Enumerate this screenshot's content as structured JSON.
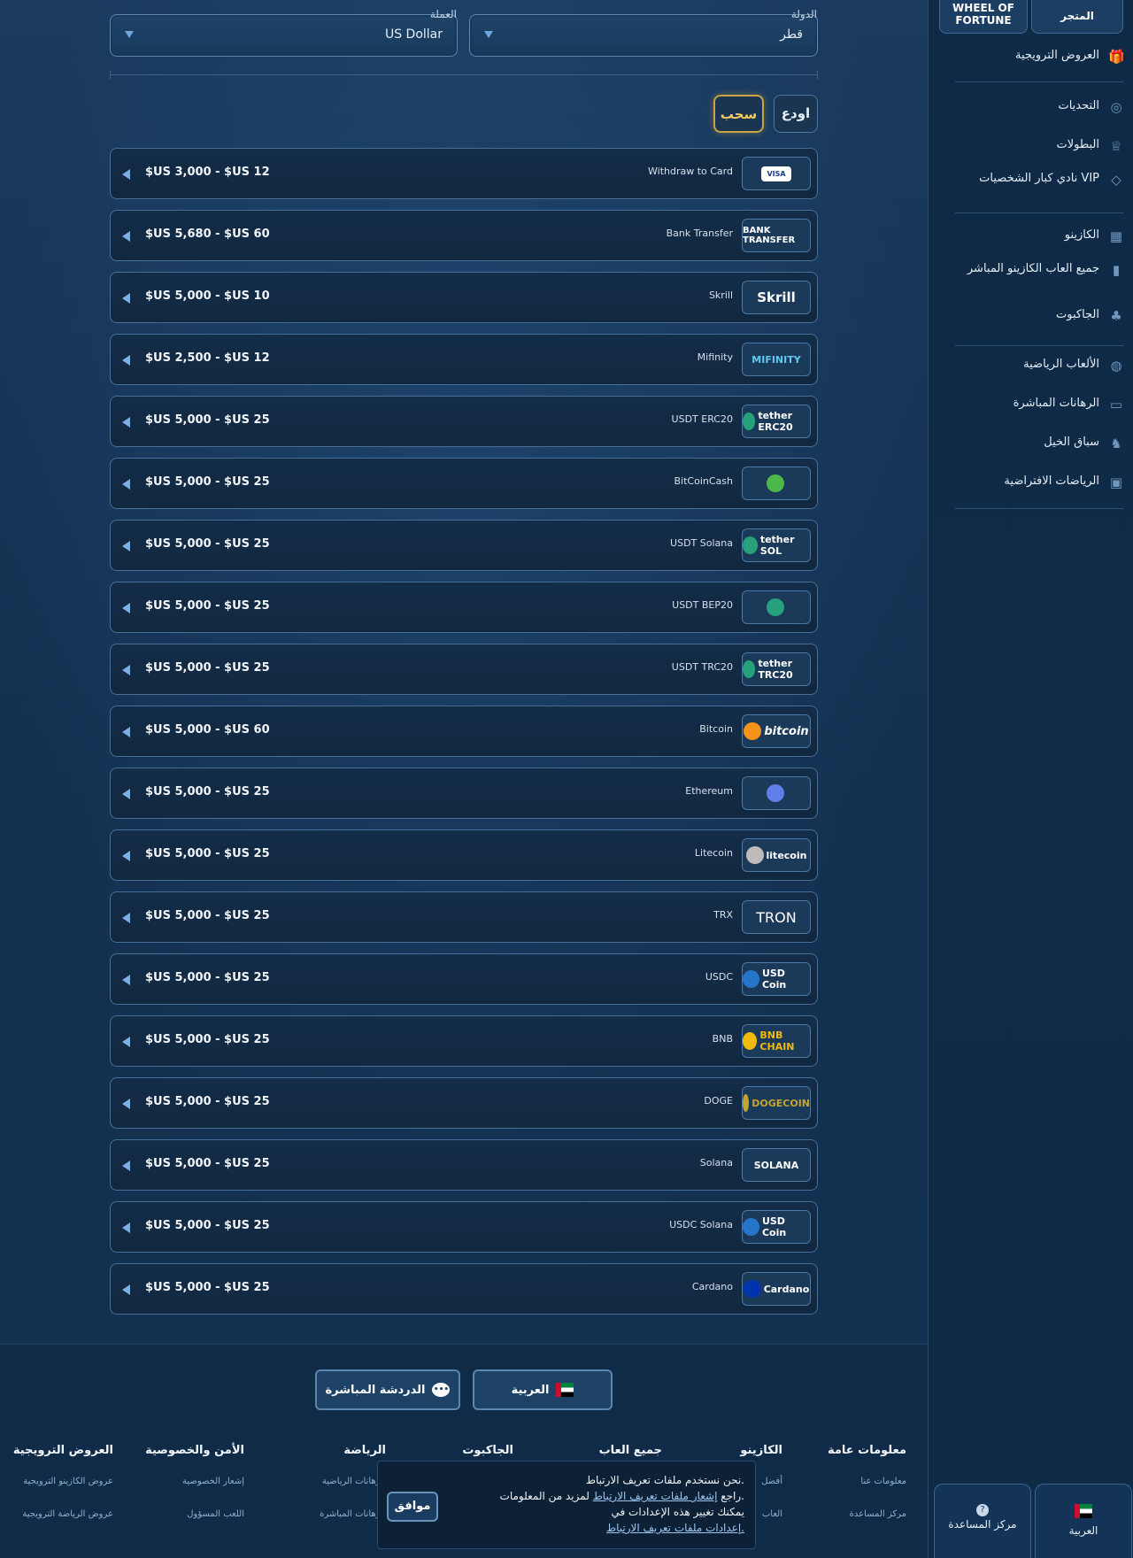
{
  "filters": {
    "country_label": "الدولة",
    "country_value": "قطر",
    "currency_label": "العملة",
    "currency_value": "US Dollar"
  },
  "tabs": {
    "withdraw": "سحب",
    "deposit": "اودع"
  },
  "methods": [
    {
      "name": "Withdraw to Card",
      "limits": "$US 3,000 - $US 12",
      "logo": "VISA"
    },
    {
      "name": "Bank Transfer",
      "limits": "$US 5,680 - $US 60",
      "logo": "BANK TRANSFER"
    },
    {
      "name": "Skrill",
      "limits": "$US 5,000 - $US 10",
      "logo": "Skrill"
    },
    {
      "name": "Mifinity",
      "limits": "$US 2,500 - $US 12",
      "logo": "MIFINITY"
    },
    {
      "name": "USDT ERC20",
      "limits": "$US 5,000 - $US 25",
      "logo": "tether ERC20"
    },
    {
      "name": "BitCoinCash",
      "limits": "$US 5,000 - $US 25",
      "logo": "₿"
    },
    {
      "name": "USDT Solana",
      "limits": "$US 5,000 - $US 25",
      "logo": "tether SOL"
    },
    {
      "name": "USDT BEP20",
      "limits": "$US 5,000 - $US 25",
      "logo": "T"
    },
    {
      "name": "USDT TRC20",
      "limits": "$US 5,000 - $US 25",
      "logo": "tether TRC20"
    },
    {
      "name": "Bitcoin",
      "limits": "$US 5,000 - $US 60",
      "logo": "bitcoin"
    },
    {
      "name": "Ethereum",
      "limits": "$US 5,000 - $US 25",
      "logo": "◆"
    },
    {
      "name": "Litecoin",
      "limits": "$US 5,000 - $US 25",
      "logo": "litecoin"
    },
    {
      "name": "TRX",
      "limits": "$US 5,000 - $US 25",
      "logo": "TRON"
    },
    {
      "name": "USDC",
      "limits": "$US 5,000 - $US 25",
      "logo": "USD Coin"
    },
    {
      "name": "BNB",
      "limits": "$US 5,000 - $US 25",
      "logo": "BNB CHAIN"
    },
    {
      "name": "DOGE",
      "limits": "$US 5,000 - $US 25",
      "logo": "DOGECOIN"
    },
    {
      "name": "Solana",
      "limits": "$US 5,000 - $US 25",
      "logo": "SOLANA"
    },
    {
      "name": "USDC Solana",
      "limits": "$US 5,000 - $US 25",
      "logo": "USD Coin"
    },
    {
      "name": "Cardano",
      "limits": "$US 5,000 - $US 25",
      "logo": "Cardano"
    }
  ],
  "sidebar": {
    "store": "المتجر",
    "wheel": "WHEEL OF FORTUNE",
    "items": [
      {
        "label": "العروض الترويجية",
        "icon": "gift-icon"
      },
      {
        "label": "التحديات",
        "icon": "medal-icon"
      },
      {
        "label": "البطولات",
        "icon": "trophy-icon"
      },
      {
        "label": "نادي كبار الشخصيات VIP",
        "icon": "diamond-icon"
      },
      {
        "label": "الكازينو",
        "icon": "slot-icon"
      },
      {
        "label": "جميع العاب الكازينو المباشر",
        "icon": "cards-icon"
      },
      {
        "label": "الجاكبوت",
        "icon": "clover-icon"
      },
      {
        "label": "الألعاب الرياضية",
        "icon": "ball-icon"
      },
      {
        "label": "الرهانات المباشرة",
        "icon": "live-icon"
      },
      {
        "label": "سباق الخيل",
        "icon": "horse-icon"
      },
      {
        "label": "الرياضات الافتراضية",
        "icon": "virtual-icon"
      }
    ],
    "lang": "العربية",
    "help": "مركز المساعدة"
  },
  "footer": {
    "lang_button": "العربية",
    "chat_button": "الدردشة المباشرة",
    "columns": [
      {
        "title": "معلومات عامة",
        "links": [
          "معلومات عنا",
          "مركز المساعدة"
        ]
      },
      {
        "title": "الكازينو",
        "links": [
          "أفضل",
          "العاب"
        ]
      },
      {
        "title": "جميع العاب",
        "links": []
      },
      {
        "title": "الجاكبوت",
        "links": []
      },
      {
        "title": "الرياضة",
        "links": [
          "الرهانات الرياضية",
          "الرهانات المباشرة"
        ]
      },
      {
        "title": "الأمن والخصوصية",
        "links": [
          "إشعار الخصوصية",
          "اللعب المسؤول"
        ]
      },
      {
        "title": "العروض الترويجية",
        "links": [
          "عروض الكازينو الترويجية",
          "عروض الرياضة الترويجية"
        ]
      }
    ]
  },
  "cookie": {
    "line1": "نحن نستخدم ملفات تعريف الارتباط.",
    "line2_pre": "راجع",
    "line2_link": "إشعار ملفات تعريف الارتباط",
    "line2_post": "لمزيد من المعلومات.",
    "line3": "يمكنك تغيير هذه الإعدادات في",
    "line4_link": "إعدادات ملفات تعريف الارتباط.",
    "ok": "موافق"
  }
}
